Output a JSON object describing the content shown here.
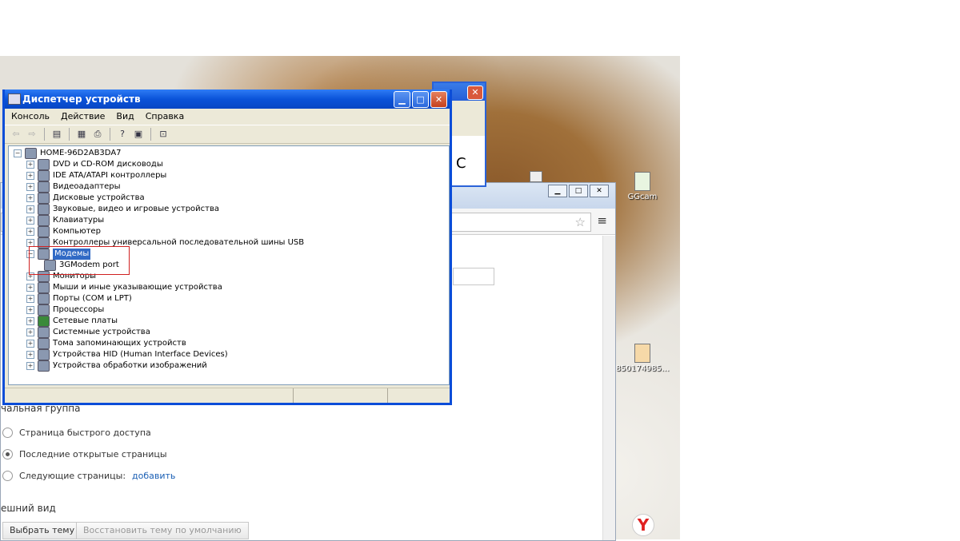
{
  "device_manager": {
    "title": "Диспетчер устройств",
    "menu": [
      "Консоль",
      "Действие",
      "Вид",
      "Справка"
    ],
    "tree": {
      "root": "HOME-96D2AB3DA7",
      "items": [
        "DVD и CD-ROM дисководы",
        "IDE ATA/ATAPI контроллеры",
        "Видеоадаптеры",
        "Дисковые устройства",
        "Звуковые, видео и игровые устройства",
        "Клавиатуры",
        "Компьютер",
        "Контроллеры универсальной последовательной шины USB",
        "Модемы",
        "Мониторы",
        "Мыши и иные указывающие устройства",
        "Порты (COM и LPT)",
        "Процессоры",
        "Сетевые платы",
        "Системные устройства",
        "Тома запоминающих устройств",
        "Устройства HID (Human Interface Devices)",
        "Устройства обработки изображений"
      ],
      "selected": "Модемы",
      "modem_child": "3GModem port"
    }
  },
  "desktop_icons": {
    "ggcam": "GGcam",
    "file": "850174985..."
  },
  "settings": {
    "section_start": "чальная группа",
    "options": [
      "Страница быстрого доступа",
      "Последние открытые страницы",
      "Следующие страницы:"
    ],
    "add_link": "добавить",
    "section_appearance": "ешний вид",
    "choose_theme": "Выбрать тему",
    "reset_theme": "Восстановить тему по умолчанию"
  },
  "background_window": {
    "partial_text": "С"
  }
}
